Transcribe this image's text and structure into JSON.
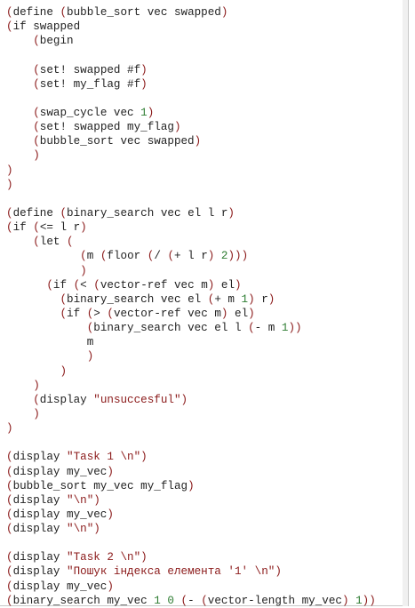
{
  "code_lines": [
    "(define (bubble_sort vec swapped)",
    "(if swapped",
    "    (begin",
    "",
    "    (set! swapped #f)",
    "    (set! my_flag #f)",
    "",
    "    (swap_cycle vec 1)",
    "    (set! swapped my_flag)",
    "    (bubble_sort vec swapped)",
    "    )",
    ")",
    ")",
    "",
    "(define (binary_search vec el l r)",
    "(if (<= l r)",
    "    (let (",
    "           (m (floor (/ (+ l r) 2)))",
    "           )",
    "      (if (< (vector-ref vec m) el)",
    "        (binary_search vec el (+ m 1) r)",
    "        (if (> (vector-ref vec m) el)",
    "            (binary_search vec el l (- m 1))",
    "            m",
    "            )",
    "        )",
    "    )",
    "    (display \"unsuccesful\")",
    "    )",
    ")",
    "",
    "(display \"Task 1 \\n\")",
    "(display my_vec)",
    "(bubble_sort my_vec my_flag)",
    "(display \"\\n\")",
    "(display my_vec)",
    "(display \"\\n\")",
    "",
    "(display \"Task 2 \\n\")",
    "(display \"Пошук індекса елемента '1' \\n\")",
    "(display my_vec)",
    "(binary_search my_vec 1 0 (- (vector-length my_vec) 1))"
  ],
  "colors": {
    "paren": "#8b1a1a",
    "string": "#8b1a1a",
    "number": "#2e7d32",
    "identifier": "#222222",
    "background": "#ffffff"
  }
}
